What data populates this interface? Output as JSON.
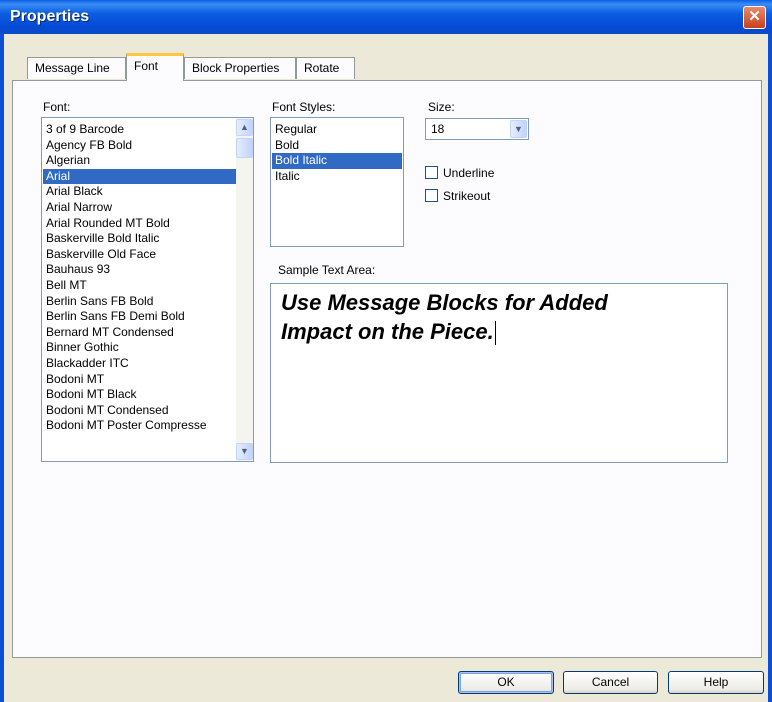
{
  "window": {
    "title": "Properties",
    "close_glyph": "✕"
  },
  "tabs": [
    {
      "label": "Message Line"
    },
    {
      "label": "Font"
    },
    {
      "label": "Block Properties"
    },
    {
      "label": "Rotate"
    }
  ],
  "font": {
    "label": "Font:",
    "items": [
      "3 of 9 Barcode",
      "Agency FB Bold",
      "Algerian",
      "Arial",
      "Arial Black",
      "Arial Narrow",
      "Arial Rounded MT Bold",
      "Baskerville Bold Italic",
      "Baskerville Old Face",
      "Bauhaus 93",
      "Bell MT",
      "Berlin Sans FB Bold",
      "Berlin Sans FB Demi Bold",
      "Bernard MT Condensed",
      "Binner Gothic",
      "Blackadder ITC",
      "Bodoni MT",
      "Bodoni MT Black",
      "Bodoni MT Condensed",
      "Bodoni MT Poster Compresse"
    ],
    "selected": "Arial"
  },
  "font_styles": {
    "label": "Font Styles:",
    "items": [
      "Regular",
      "Bold",
      "Bold Italic",
      "Italic"
    ],
    "selected": "Bold Italic"
  },
  "size": {
    "label": "Size:",
    "value": "18"
  },
  "effects": {
    "underline": "Underline",
    "strikeout": "Strikeout"
  },
  "sample": {
    "label": "Sample Text Area:",
    "line1": "Use Message Blocks for Added",
    "line2": "Impact on the Piece."
  },
  "buttons": {
    "ok": "OK",
    "cancel": "Cancel",
    "help": "Help"
  },
  "glyphs": {
    "up": "▲",
    "down": "▼"
  },
  "colors": {
    "selection": "#316ac5",
    "titlebar": "#0a5fe0",
    "tab_highlight": "#ffc83c"
  }
}
